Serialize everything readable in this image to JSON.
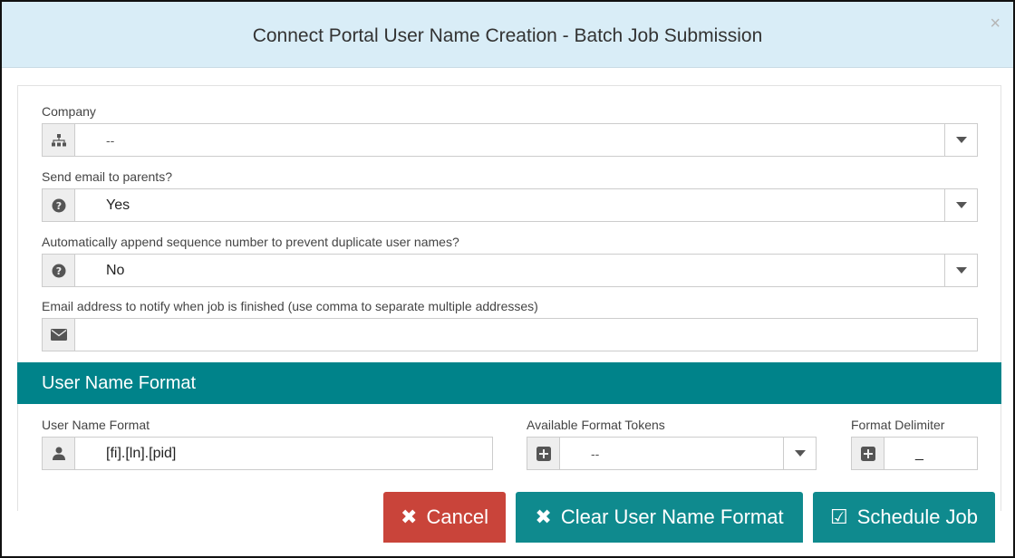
{
  "modal": {
    "title": "Connect Portal User Name Creation - Batch Job Submission",
    "close_label": "×"
  },
  "fields": {
    "company": {
      "label": "Company",
      "value": "--",
      "icon": "sitemap-icon"
    },
    "send_email": {
      "label": "Send email to parents?",
      "value": "Yes",
      "icon": "question-circle-icon"
    },
    "append_seq": {
      "label": "Automatically append sequence number to prevent duplicate user names?",
      "value": "No",
      "icon": "question-circle-icon"
    },
    "notify_email": {
      "label": "Email address to notify when job is finished (use comma to separate multiple addresses)",
      "value": "",
      "icon": "envelope-icon"
    }
  },
  "format_section": {
    "title": "User Name Format",
    "user_name_format": {
      "label": "User Name Format",
      "value": "[fi].[ln].[pid]",
      "icon": "user-icon"
    },
    "tokens": {
      "label": "Available Format Tokens",
      "value": "--",
      "icon": "plus-square-icon"
    },
    "delimiter": {
      "label": "Format Delimiter",
      "value": "_",
      "icon": "plus-square-icon"
    }
  },
  "buttons": {
    "cancel": {
      "label": "Cancel",
      "icon": "✖"
    },
    "clear": {
      "label": "Clear User Name Format",
      "icon": "✖"
    },
    "schedule": {
      "label": "Schedule Job",
      "icon": "☑"
    }
  },
  "colors": {
    "header_bg": "#d9edf7",
    "section_bg": "#00838a",
    "cancel_bg": "#c9443a",
    "primary_bg": "#0f8a8e"
  }
}
